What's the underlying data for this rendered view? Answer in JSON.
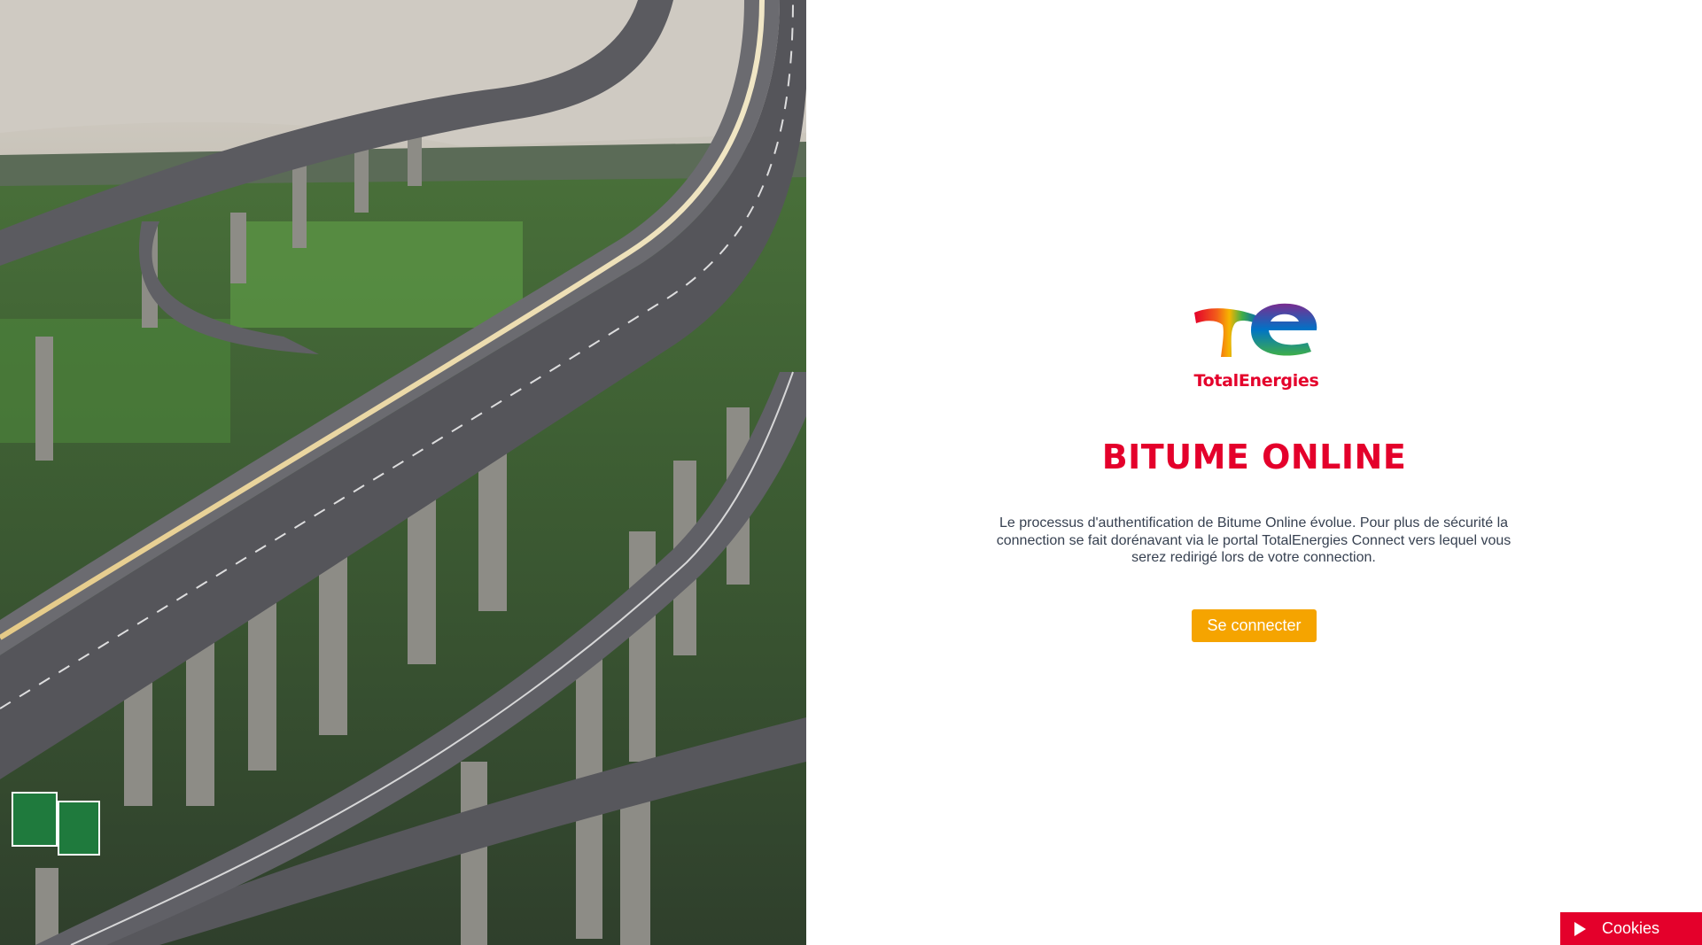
{
  "hero": {
    "image": "highway-interchange-photo"
  },
  "brand": {
    "logo_icon": "totalenergies-logo-icon",
    "name": "TotalEnergies"
  },
  "main": {
    "title": "BITUME ONLINE",
    "intro": "Le processus d'authentification de Bitume Online évolue. Pour plus de sécurité la connection se fait dorénavant via le portal TotalEnergies Connect vers lequel vous serez redirigé lors de votre connection.",
    "connect_label": "Se connecter"
  },
  "cookies": {
    "icon": "play-icon",
    "label": "Cookies"
  },
  "colors": {
    "brand_red": "#e4002b",
    "button_orange": "#f5a400",
    "text": "#374151"
  }
}
